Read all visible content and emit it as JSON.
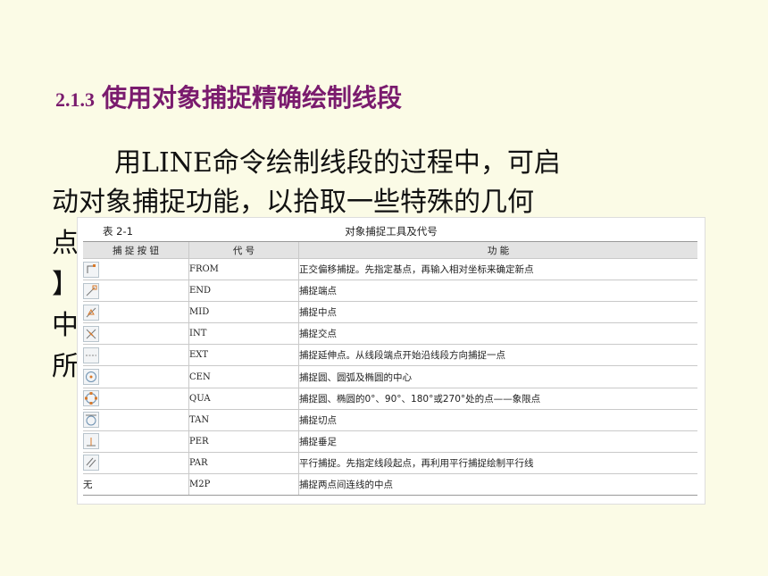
{
  "heading": {
    "number": "2.1.3",
    "title": "使用对象捕捉精确绘制线段"
  },
  "paragraph": [
    "用LINE命令绘制线段的过程中，可启",
    "动对象捕捉功能，以拾取一些特殊的几何",
    "点",
    "】",
    "中",
    "所"
  ],
  "table": {
    "caption": "表 2-1",
    "title": "对象捕捉工具及代号",
    "headers": [
      "捕 捉 按 钮",
      "代    号",
      "功    能"
    ],
    "rows": [
      {
        "icon": "from-icon",
        "code": "FROM",
        "desc": "正交偏移捕捉。先指定基点，再输入相对坐标来确定新点"
      },
      {
        "icon": "endpoint-icon",
        "code": "END",
        "desc": "捕捉端点"
      },
      {
        "icon": "midpoint-icon",
        "code": "MID",
        "desc": "捕捉中点"
      },
      {
        "icon": "intersection-icon",
        "code": "INT",
        "desc": "捕捉交点"
      },
      {
        "icon": "extension-icon",
        "code": "EXT",
        "desc": "捕捉延伸点。从线段端点开始沿线段方向捕捉一点"
      },
      {
        "icon": "center-icon",
        "code": "CEN",
        "desc": "捕捉圆、圆弧及椭圆的中心"
      },
      {
        "icon": "quadrant-icon",
        "code": "QUA",
        "desc": "捕捉圆、椭圆的0°、90°、180°或270°处的点——象限点"
      },
      {
        "icon": "tangent-icon",
        "code": "TAN",
        "desc": "捕捉切点"
      },
      {
        "icon": "perpendicular-icon",
        "code": "PER",
        "desc": "捕捉垂足"
      },
      {
        "icon": "parallel-icon",
        "code": "PAR",
        "desc": "平行捕捉。先指定线段起点，再利用平行捕捉绘制平行线"
      },
      {
        "icon": "",
        "button_text": "无",
        "code": "M2P",
        "desc": "捕捉两点间连线的中点"
      }
    ]
  }
}
